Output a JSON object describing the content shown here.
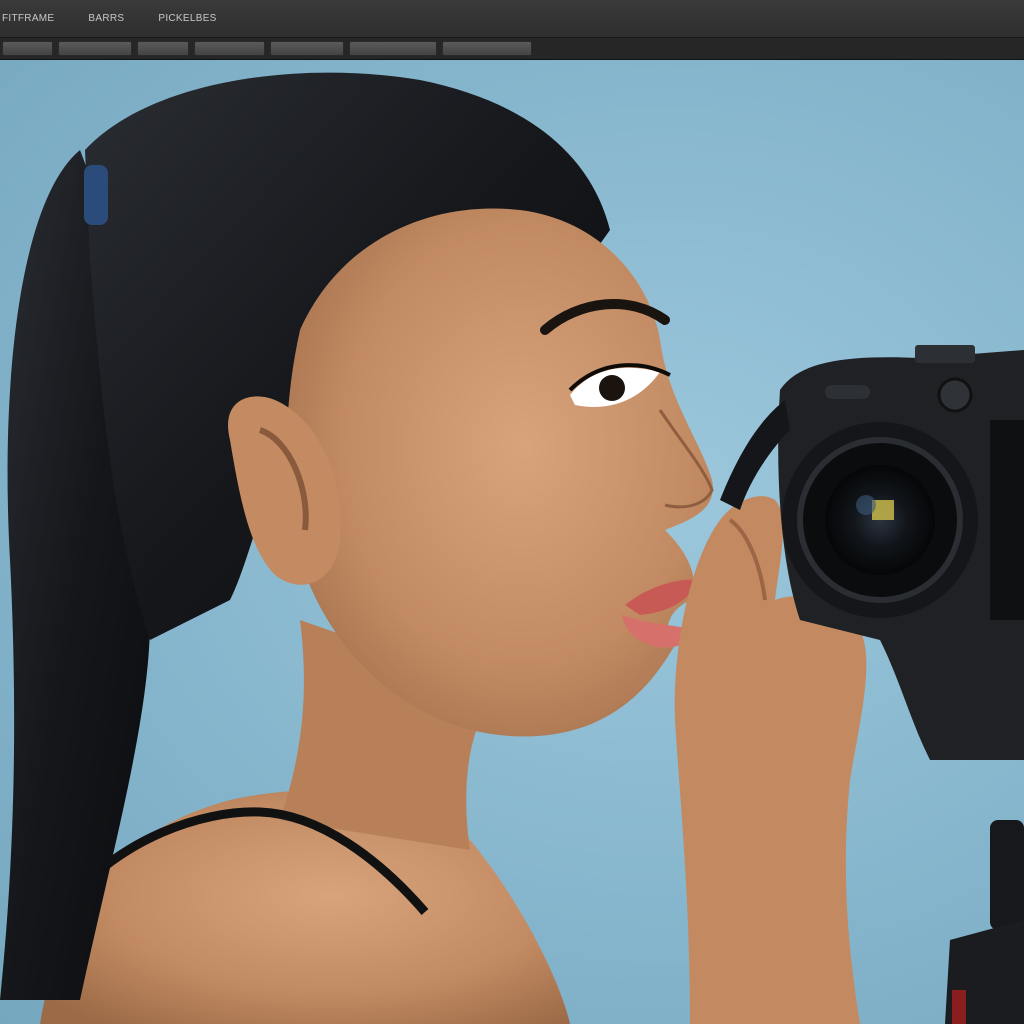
{
  "menubar": {
    "items": [
      {
        "label": "FITFRAME"
      },
      {
        "label": "BARRS"
      },
      {
        "label": "PICKELBES"
      }
    ]
  },
  "toolbar": {
    "buttons": [
      {
        "label": ""
      },
      {
        "label": ""
      },
      {
        "label": ""
      },
      {
        "label": ""
      },
      {
        "label": ""
      },
      {
        "label": ""
      },
      {
        "label": ""
      }
    ]
  },
  "canvas": {
    "subject": "woman-with-camera-photo",
    "background_color": "#8dbdd3"
  },
  "colors": {
    "menubar": "#333333",
    "toolbar": "#262626",
    "backdrop": "#8dbdd3"
  }
}
